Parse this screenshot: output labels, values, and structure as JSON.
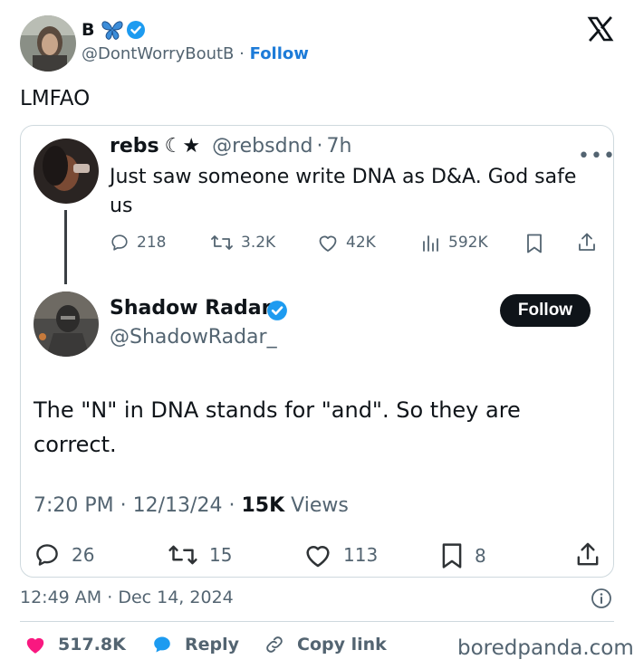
{
  "header": {
    "name": "B",
    "handle": "@DontWorryBoutB",
    "separator": "·",
    "follow_label": "Follow"
  },
  "tweet": {
    "text": "LMFAO"
  },
  "quoted_reply": {
    "name": "rebs",
    "name_glyphs": "☾★",
    "handle": "@rebsdnd",
    "separator": "·",
    "time": "7h",
    "text": "Just saw someone write DNA as D&A. God safe us",
    "actions": {
      "replies": "218",
      "reposts": "3.2K",
      "likes": "42K",
      "views": "592K"
    }
  },
  "quoted_post": {
    "name": "Shadow Radar",
    "handle": "@ShadowRadar_",
    "follow_label": "Follow",
    "text": "The \"N\" in DNA stands for \"and\". So they are correct.",
    "time": "7:20 PM",
    "date": "12/13/24",
    "separator": "·",
    "views_count": "15K",
    "views_label": "Views",
    "actions": {
      "replies": "26",
      "reposts": "15",
      "likes": "113",
      "bookmarks": "8"
    }
  },
  "post_meta": {
    "time": "12:49 AM",
    "separator": "·",
    "date": "Dec 14, 2024"
  },
  "footer": {
    "likes": "517.8K",
    "reply_label": "Reply",
    "copy_link_label": "Copy link",
    "watermark": "boredpanda.com"
  },
  "colors": {
    "accent": "#1d7bd8",
    "verified": "#1d9bf0",
    "heart": "#f91880",
    "text": "#0f1419",
    "muted": "#536471"
  }
}
